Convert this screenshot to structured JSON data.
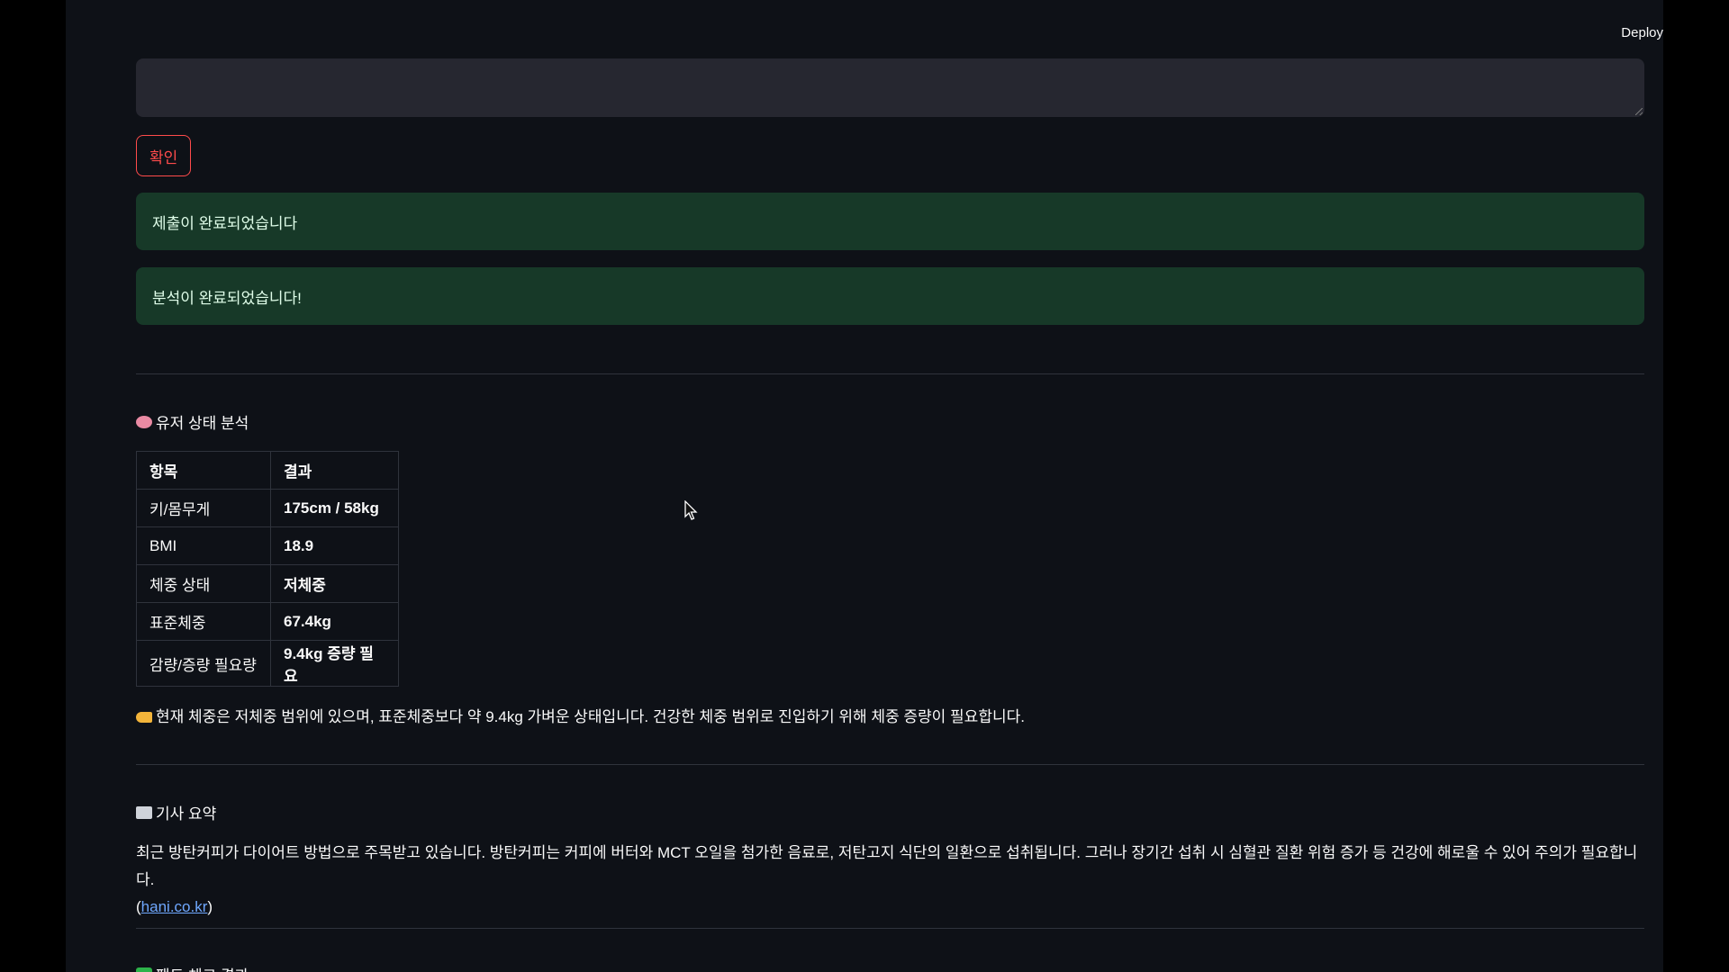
{
  "header": {
    "deploy_label": "Deploy"
  },
  "form": {
    "textarea_value": "",
    "confirm_label": "확인"
  },
  "alerts": [
    {
      "text": "제출이 완료되었습니다"
    },
    {
      "text": "분석이 완료되었습니다!"
    }
  ],
  "user_analysis": {
    "title": "유저 상태 분석",
    "icon": "brain-icon",
    "table": {
      "headers": [
        "항목",
        "결과"
      ],
      "rows": [
        [
          "키/몸무게",
          "175cm / 58kg"
        ],
        [
          "BMI",
          "18.9"
        ],
        [
          "체중 상태",
          "저체중"
        ],
        [
          "표준체중",
          "67.4kg"
        ],
        [
          "감량/증량 필요량",
          "9.4kg 증량 필요"
        ]
      ]
    },
    "note_icon": "pointing-hand-icon",
    "note": "현재 체중은 저체중 범위에 있으며, 표준체중보다 약 9.4kg 가벼운 상태입니다. 건강한 체중 범위로 진입하기 위해 체중 증량이 필요합니다."
  },
  "article_summary": {
    "title": "기사 요약",
    "icon": "newspaper-icon",
    "text": "최근 방탄커피가 다이어트 방법으로 주목받고 있습니다. 방탄커피는 커피에 버터와 MCT 오일을 첨가한 음료로, 저탄고지 식단의 일환으로 섭취됩니다. 그러나 장기간 섭취 시 심혈관 질환 위험 증가 등 건강에 해로울 수 있어 주의가 필요합니다.",
    "source_open": "(",
    "source_link": "hani.co.kr",
    "source_close": ")"
  },
  "fact_check": {
    "title": "팩트 체크 결과",
    "icon": "check-box-icon"
  },
  "colors": {
    "background": "#0e1117",
    "accent": "#ff4b4b",
    "success_bg": "#173928",
    "success_text": "#dffde9",
    "link": "#6fa8ff"
  }
}
